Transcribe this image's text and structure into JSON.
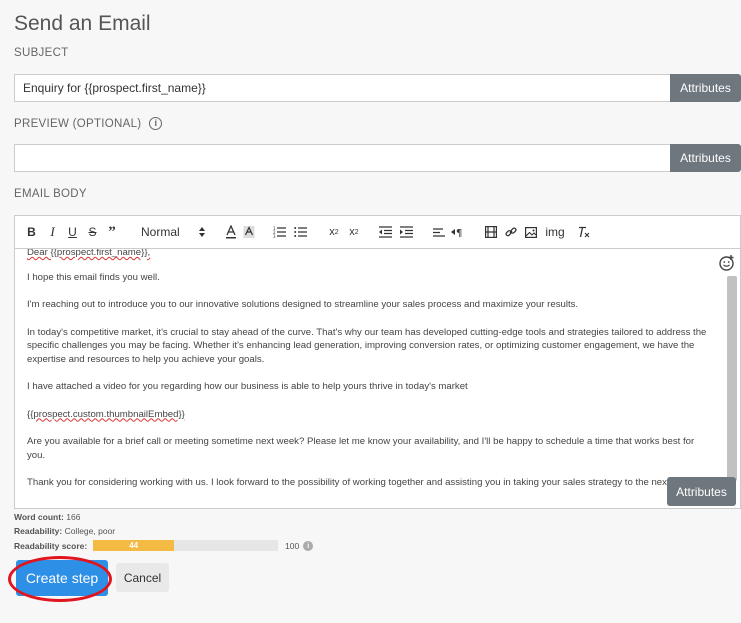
{
  "page": {
    "title": "Send an Email"
  },
  "subject": {
    "label": "SUBJECT",
    "value": "Enquiry for {{prospect.first_name}}",
    "attributes_label": "Attributes"
  },
  "preview": {
    "label": "PREVIEW (OPTIONAL)",
    "value": "",
    "attributes_label": "Attributes",
    "info_icon": "info-circle-icon"
  },
  "body": {
    "label": "EMAIL BODY",
    "toolbar": {
      "format_select": "Normal",
      "img_label": "img"
    },
    "greeting_visible": "Dear {{prospect.first_name}},",
    "paragraphs": [
      "I hope this email finds you well.",
      " I'm reaching out to introduce you to our innovative solutions designed to streamline your sales process and maximize your results.",
      "In today's competitive market, it's crucial to stay ahead of the curve. That's why our team has developed cutting-edge tools and strategies tailored to address the specific challenges you may be facing. Whether it's enhancing lead generation, improving conversion rates, or optimizing customer engagement, we have the expertise and resources to help you achieve your goals.",
      "I have attached a video for you regarding how our business is able to help yours thrive in today's market",
      "{{prospect.custom.thumbnailEmbed}}",
      "Are you available for a brief call or meeting sometime next week? Please let me know your availability, and I'll be happy to schedule a time that works best for you.",
      "Thank you for considering working with us. I look forward to the possibility of working together and assisting you in taking your sales strategy to the next level."
    ],
    "attributes_label": "Attributes"
  },
  "stats": {
    "word_count_label": "Word count:",
    "word_count": "166",
    "readability_label": "Readability:",
    "readability": "College, poor",
    "score_label": "Readability score:",
    "score": "44",
    "score_fraction": 0.44,
    "score_max": "100"
  },
  "actions": {
    "create_label": "Create step",
    "cancel_label": "Cancel"
  },
  "colors": {
    "attributes_bg": "#6e767e",
    "primary": "#2d8fe6",
    "score_fill": "#f4bb44",
    "highlight_oval": "#e0151f"
  }
}
